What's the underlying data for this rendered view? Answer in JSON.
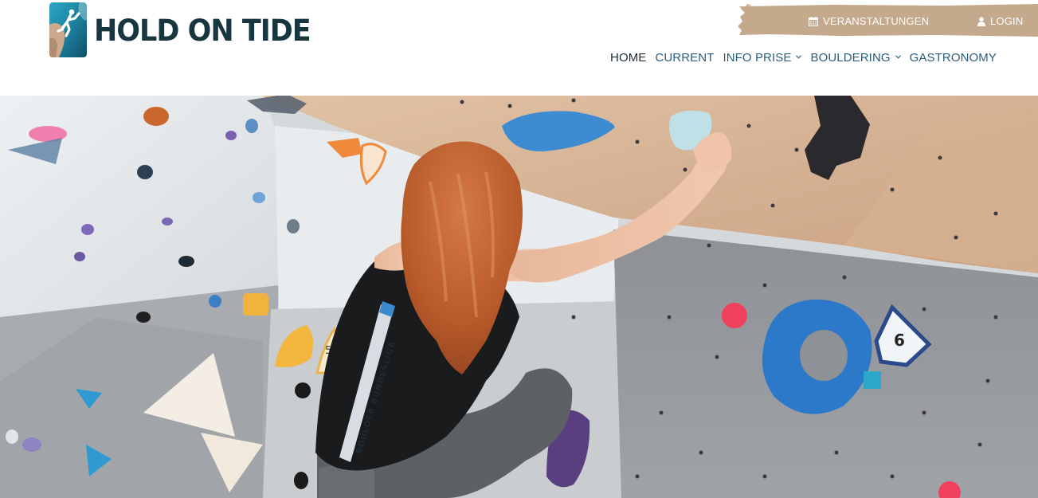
{
  "brand": {
    "name": "HOLD ON TIDE",
    "logo_icon": "climber-logo-icon"
  },
  "topbar": {
    "events_label": "VERANSTALTUNGEN",
    "events_icon": "calendar-icon",
    "login_label": "LOGIN",
    "login_icon": "user-icon",
    "color": "#c5a98c"
  },
  "nav": {
    "items": [
      {
        "label": "HOME",
        "active": true,
        "dropdown": false
      },
      {
        "label": "CURRENT",
        "active": false,
        "dropdown": false
      },
      {
        "label": "INFO PRISE",
        "active": false,
        "dropdown": true
      },
      {
        "label": "BOULDERING",
        "active": false,
        "dropdown": true
      },
      {
        "label": "GASTRONOMY",
        "active": false,
        "dropdown": false
      }
    ],
    "color": "#2a5d7c",
    "active_color": "#1d2b33"
  },
  "hero": {
    "image": "boulder-climber-photo",
    "shirt_print": "BOULDER BUNDESLIGA",
    "hold_tag_5": "5",
    "hold_tag_6": "6"
  }
}
